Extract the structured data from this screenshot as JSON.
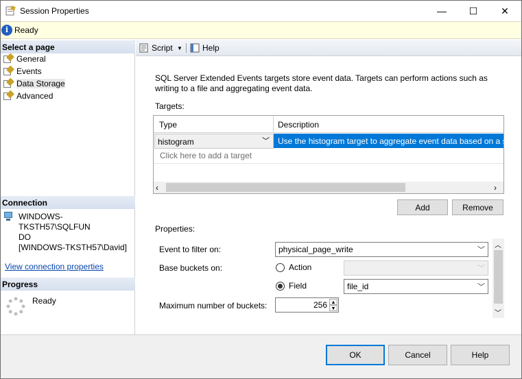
{
  "window": {
    "title": "Session Properties",
    "minimize": "—",
    "maximize": "☐",
    "close": "✕"
  },
  "status": {
    "text": "Ready",
    "icon": "info-icon"
  },
  "left_pane": {
    "select_page_header": "Select a page",
    "pages": [
      {
        "label": "General",
        "selected": false
      },
      {
        "label": "Events",
        "selected": false
      },
      {
        "label": "Data Storage",
        "selected": true
      },
      {
        "label": "Advanced",
        "selected": false
      }
    ],
    "connection_header": "Connection",
    "connection_server_line1": "WINDOWS-TKSTH57\\SQLFUN",
    "connection_server_line2": "DO",
    "connection_user": "[WINDOWS-TKSTH57\\David]",
    "view_connection_link": "View connection properties",
    "progress_header": "Progress",
    "progress_status": "Ready"
  },
  "toolbar": {
    "script_label": "Script",
    "help_label": "Help"
  },
  "main": {
    "description": "SQL Server Extended Events targets store event data. Targets can perform actions such as writing to a file and aggregating event data.",
    "targets_label": "Targets:",
    "targets_grid": {
      "columns": [
        "Type",
        "Description"
      ],
      "rows": [
        {
          "type": "histogram",
          "description": "Use the histogram target to aggregate event data based on a sp"
        }
      ],
      "add_placeholder": "Click here to add a target"
    },
    "add_button": "Add",
    "remove_button": "Remove",
    "properties_label": "Properties:",
    "properties": {
      "event_filter_label": "Event to filter on:",
      "event_filter_value": "physical_page_write",
      "base_buckets_label": "Base buckets on:",
      "action_label": "Action",
      "action_value": "",
      "field_label": "Field",
      "field_value": "file_id",
      "selected_basis": "Field",
      "max_buckets_label": "Maximum number of buckets:",
      "max_buckets_value": "256"
    }
  },
  "footer": {
    "ok": "OK",
    "cancel": "Cancel",
    "help": "Help"
  },
  "colors": {
    "selection": "#0078d7",
    "status_bg": "#ffffe1",
    "section_header": "#d5dfee",
    "link": "#0645ad"
  }
}
